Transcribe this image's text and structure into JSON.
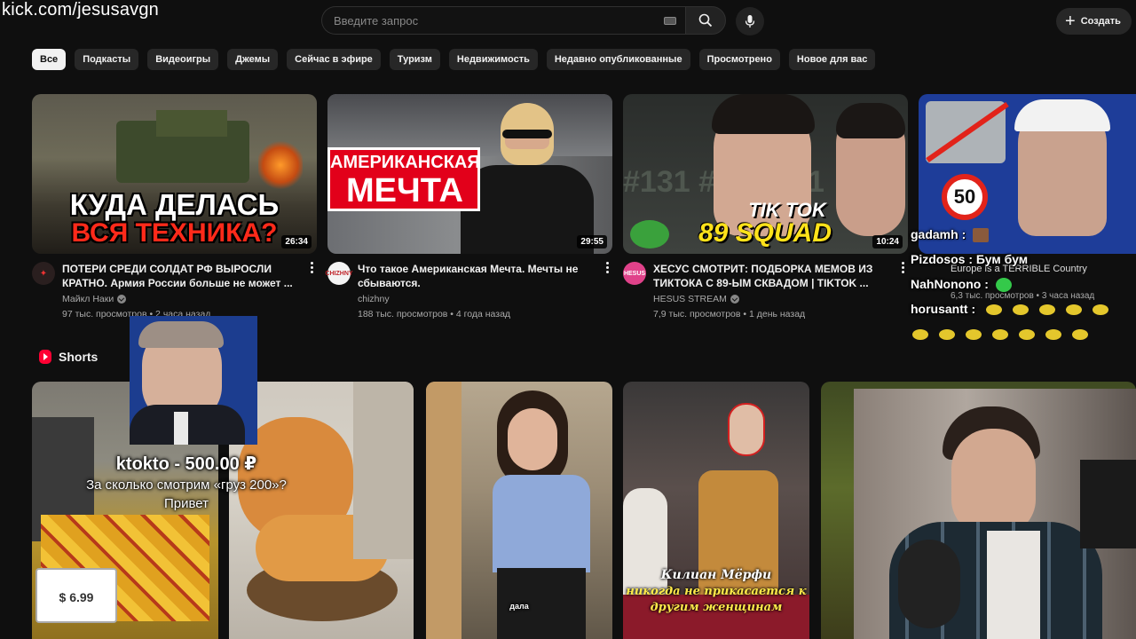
{
  "watermark": "kick.com/jesusavgn",
  "search": {
    "placeholder": "Введите запрос"
  },
  "header": {
    "create_label": "Создать"
  },
  "chips": [
    "Все",
    "Подкасты",
    "Видеоигры",
    "Джемы",
    "Сейчас в эфире",
    "Туризм",
    "Недвижимость",
    "Недавно опубликованные",
    "Просмотрено",
    "Новое для вас"
  ],
  "videos": [
    {
      "thumb_line1": "КУДА ДЕЛАСЬ",
      "thumb_line2": "ВСЯ ТЕХНИКА?",
      "duration": "26:34",
      "title": "ПОТЕРИ СРЕДИ СОЛДАТ РФ ВЫРОСЛИ КРАТНО. Армия России больше не может ...",
      "channel": "Майкл Наки",
      "stats": "97 тыс. просмотров • 2 часа назад"
    },
    {
      "thumb_line1": "АМЕРИКАНСКАЯ",
      "thumb_line2": "МЕЧТА",
      "duration": "29:55",
      "title": "Что такое Американская Мечта. Мечты не сбываются.",
      "channel": "chizhny",
      "stats": "188 тыс. просмотров • 4 года назад"
    },
    {
      "thumb_line1": "TIK TOK",
      "thumb_line2": "89 SQUAD",
      "duration": "10:24",
      "title": "ХЕСУС СМОТРИТ: ПОДБОРКА МЕМОВ ИЗ ТИКТОКА С 89-ЫМ СКВАДОМ | TIKTOK ...",
      "channel": "HESUS STREAM",
      "stats": "7,9 тыс. просмотров • 1 день назад"
    },
    {
      "thumb_badge": "50",
      "title": "Europe is a TERRIBLE Country",
      "stats": "6,3 тыс. просмотров • 3 часа назад"
    }
  ],
  "shorts": {
    "title": "Shorts",
    "items": [
      {
        "caption": "",
        "price_tag": "$ 6.99"
      },
      {
        "caption": ""
      },
      {
        "caption": "дала"
      },
      {
        "caption_line1": "Килиан Мёрфи",
        "caption_line2": "никогда не прикасается к",
        "caption_line3": "другим женщинам"
      },
      {
        "caption": ""
      }
    ]
  },
  "donation": {
    "name": "ktokto - 500.00 ₽",
    "message_line1": "За сколько смотрим «груз 200»?",
    "message_line2": "Привет"
  },
  "chat": [
    {
      "user": "gadamh :"
    },
    {
      "user": "Pizdosos :",
      "text": "Бум бум"
    },
    {
      "user": "NahNonono :"
    },
    {
      "user": "horusantt :"
    }
  ]
}
